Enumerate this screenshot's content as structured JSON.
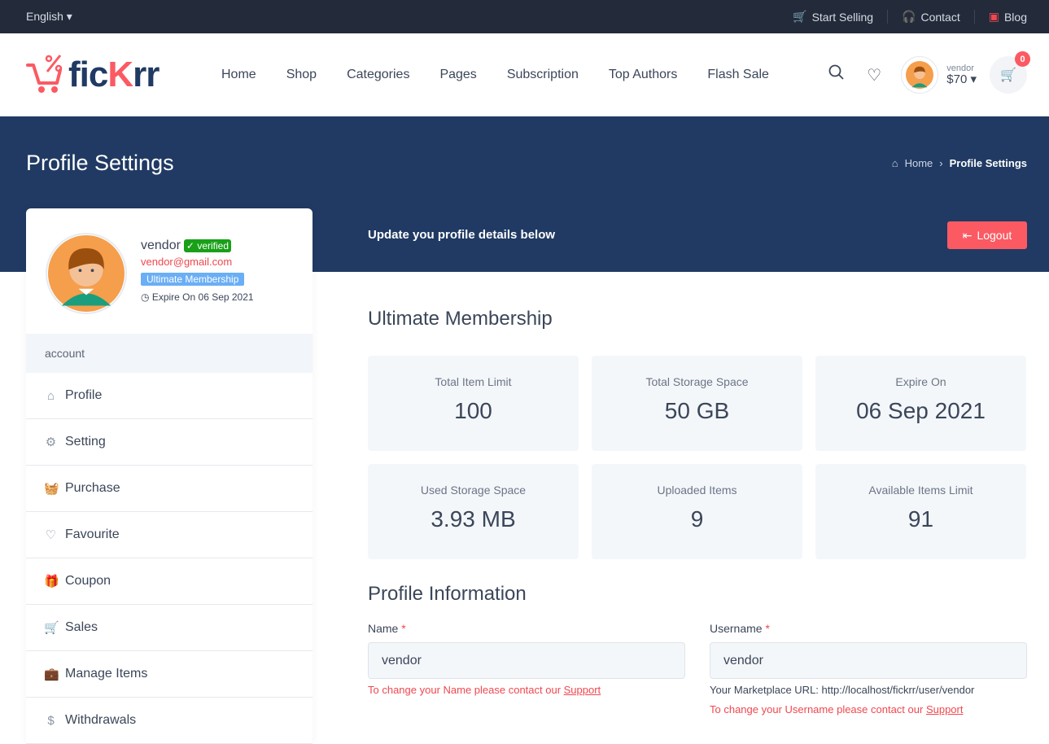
{
  "topbar": {
    "language": "English",
    "links": [
      {
        "label": "Start Selling",
        "icon": "cart-icon"
      },
      {
        "label": "Contact",
        "icon": "headset-icon"
      },
      {
        "label": "Blog",
        "icon": "image-icon"
      }
    ]
  },
  "header": {
    "logo": {
      "a": "fic",
      "b": "K",
      "c": "rr"
    },
    "nav": [
      "Home",
      "Shop",
      "Categories",
      "Pages",
      "Subscription",
      "Top Authors",
      "Flash Sale"
    ],
    "user": "vendor",
    "balance": "$70",
    "cart_count": "0"
  },
  "hero": {
    "title": "Profile Settings",
    "breadcrumb": [
      "Home",
      "Profile Settings"
    ],
    "subtitle": "Update you profile details below",
    "logout": "Logout"
  },
  "profile": {
    "name": "vendor",
    "verified": "verified",
    "email": "vendor@gmail.com",
    "membership": "Ultimate Membership",
    "expire": "Expire On 06 Sep 2021"
  },
  "sidebar": {
    "section": "account",
    "items": [
      {
        "label": "Profile",
        "icon": "⌂"
      },
      {
        "label": "Setting",
        "icon": "⚙"
      },
      {
        "label": "Purchase",
        "icon": "🧺"
      },
      {
        "label": "Favourite",
        "icon": "♡"
      },
      {
        "label": "Coupon",
        "icon": "🎁"
      },
      {
        "label": "Sales",
        "icon": "🛒"
      },
      {
        "label": "Manage Items",
        "icon": "💼"
      },
      {
        "label": "Withdrawals",
        "icon": "$"
      }
    ]
  },
  "membership": {
    "title": "Ultimate Membership",
    "stats": [
      {
        "label": "Total Item Limit",
        "value": "100"
      },
      {
        "label": "Total Storage Space",
        "value": "50 GB"
      },
      {
        "label": "Expire On",
        "value": "06 Sep 2021"
      },
      {
        "label": "Used Storage Space",
        "value": "3.93 MB"
      },
      {
        "label": "Uploaded Items",
        "value": "9"
      },
      {
        "label": "Available Items Limit",
        "value": "91"
      }
    ]
  },
  "profile_info": {
    "title": "Profile Information",
    "name": {
      "label": "Name",
      "value": "vendor",
      "note": "To change your Name please contact our ",
      "link": "Support"
    },
    "username": {
      "label": "Username",
      "value": "vendor",
      "url": "Your Marketplace URL: http://localhost/fickrr/user/vendor",
      "note": "To change your Username please contact our ",
      "link": "Support"
    }
  },
  "colors": {
    "accent": "#fb5a63",
    "navy": "#203a63",
    "topbar": "#232b3b"
  }
}
